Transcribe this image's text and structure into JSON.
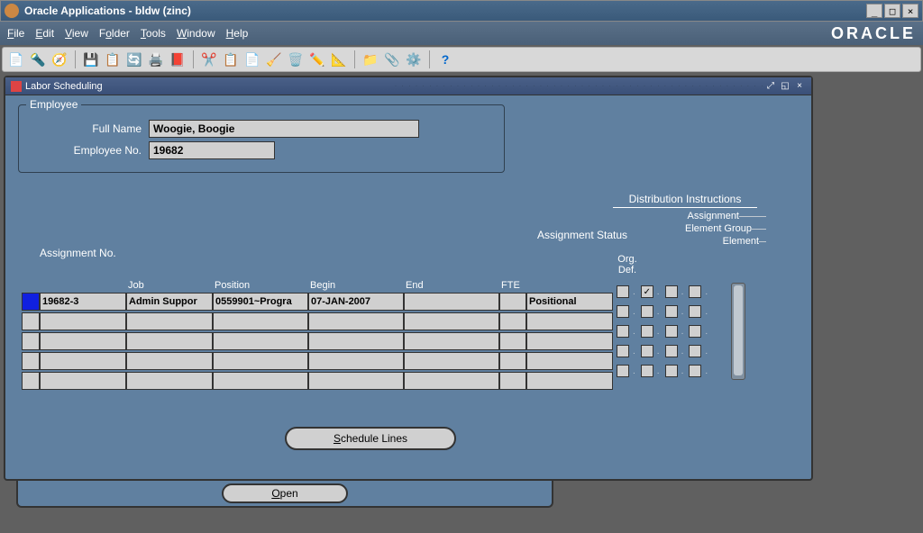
{
  "window": {
    "title": "Oracle Applications - bldw (zinc)"
  },
  "menu": {
    "file": "File",
    "edit": "Edit",
    "view": "View",
    "folder": "Folder",
    "tools": "Tools",
    "window": "Window",
    "help": "Help"
  },
  "logo": "ORACLE",
  "form": {
    "title": "Labor Scheduling"
  },
  "employee": {
    "section": "Employee",
    "full_name_label": "Full Name",
    "full_name": "Woogie, Boogie",
    "emp_no_label": "Employee No.",
    "emp_no": "19682"
  },
  "labels": {
    "dist": "Distribution Instructions",
    "assignment": "Assignment",
    "element_group": "Element Group",
    "element": "Element",
    "assign_status": "Assignment Status",
    "assign_no": "Assignment No.",
    "org_def": "Org.\nDef."
  },
  "columns": {
    "job": "Job",
    "position": "Position",
    "begin": "Begin",
    "end": "End",
    "fte": "FTE"
  },
  "rows": [
    {
      "selected": true,
      "assign_no": "19682-3",
      "job": "Admin Suppor",
      "position": "0559901~Progra",
      "begin": "07-JAN-2007",
      "end": "",
      "fte": "",
      "status": "Positional",
      "org": false,
      "assignment": true,
      "elgroup": false,
      "element": false
    },
    {
      "selected": false,
      "assign_no": "",
      "job": "",
      "position": "",
      "begin": "",
      "end": "",
      "fte": "",
      "status": "",
      "org": false,
      "assignment": false,
      "elgroup": false,
      "element": false
    },
    {
      "selected": false,
      "assign_no": "",
      "job": "",
      "position": "",
      "begin": "",
      "end": "",
      "fte": "",
      "status": "",
      "org": false,
      "assignment": false,
      "elgroup": false,
      "element": false
    },
    {
      "selected": false,
      "assign_no": "",
      "job": "",
      "position": "",
      "begin": "",
      "end": "",
      "fte": "",
      "status": "",
      "org": false,
      "assignment": false,
      "elgroup": false,
      "element": false
    },
    {
      "selected": false,
      "assign_no": "",
      "job": "",
      "position": "",
      "begin": "",
      "end": "",
      "fte": "",
      "status": "",
      "org": false,
      "assignment": false,
      "elgroup": false,
      "element": false
    }
  ],
  "buttons": {
    "schedule": "Schedule Lines",
    "open": "Open"
  }
}
